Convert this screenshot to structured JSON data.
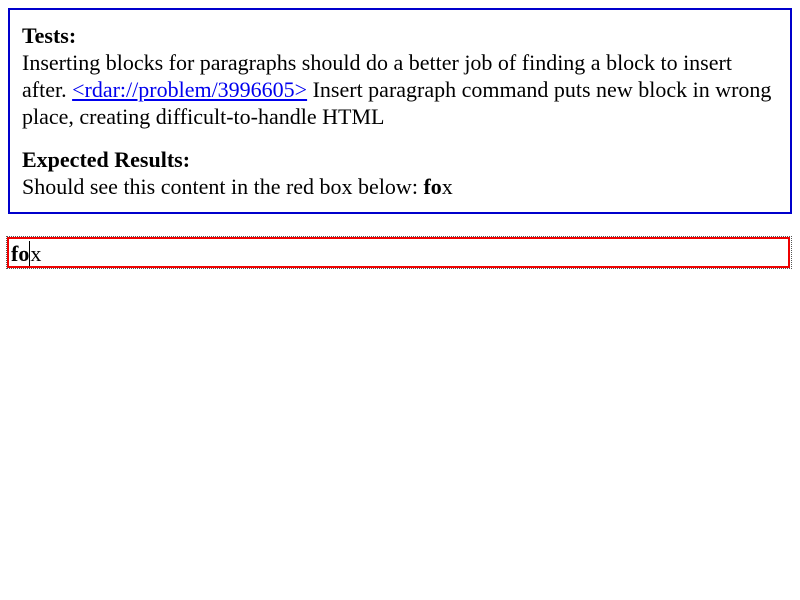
{
  "explanation": {
    "tests_heading": "Tests:",
    "tests_text_before": "Inserting blocks for paragraphs should do a better job of finding a block to insert after. ",
    "tests_link": "<rdar://problem/3996605>",
    "tests_text_after": " Insert paragraph command puts new block in wrong place, creating difficult-to-handle HTML",
    "expected_heading": "Expected Results:",
    "expected_text": "Should see this content in the red box below: ",
    "expected_bold": "fo",
    "expected_plain": "x"
  },
  "test_box": {
    "bold_text": "fo",
    "plain_text": "x"
  },
  "colors": {
    "explanation_border": "#0000cc",
    "test_border": "#ee0000",
    "link": "#0000ee"
  }
}
